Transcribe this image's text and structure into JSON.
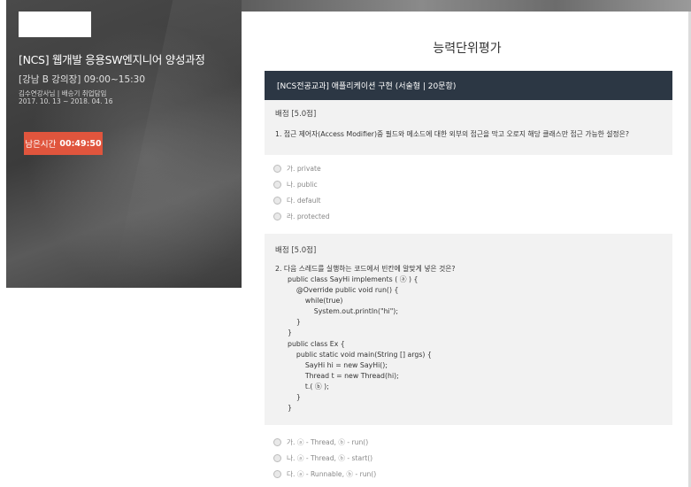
{
  "hero": {
    "title": "[NCS] 웹개발 응용SW엔지니어 양성과정",
    "time": "[강남 B 강의장] 09:00~15:30",
    "instructor": "김수연강사님 | 배승기 취업담임",
    "dates": "2017. 10. 13 ~ 2018. 04. 16",
    "timer_label": "남은시간",
    "timer_value": "00:49:50"
  },
  "main": {
    "title": "능력단위평가",
    "section": "[NCS전공교과] 애플리케이션 구현 (서술형 | 20문항)"
  },
  "questions": [
    {
      "score": "배점 [5.0점]",
      "text": "1.  접근 제어자(Access Modifier)중 필드와 메소드에 대한 외부의 접근을 막고 오로지 해당 클래스만 접근 가능한 설정은?",
      "options": [
        "가. private",
        "나. public",
        "다. default",
        "라. protected"
      ]
    },
    {
      "score": "배점 [5.0점]",
      "text": "2.  다음 스레드를 실행하는 코드에서 빈칸에 알맞게 넣은 것은?",
      "code": "public class SayHi implements ( ⓐ ) {\n    @Override public void run() {\n        while(true)\n            System.out.println(\"hi\");\n    }\n}\npublic class Ex {\n    public static void main(String [] args) {\n        SayHi hi = new SayHi();\n        Thread t = new Thread(hi);\n        t.( ⓑ );\n    }\n}",
      "options": [
        "가. ⓐ - Thread, ⓑ - run()",
        "나. ⓐ - Thread, ⓑ - start()",
        "다. ⓐ - Runnable, ⓑ - run()"
      ]
    }
  ]
}
